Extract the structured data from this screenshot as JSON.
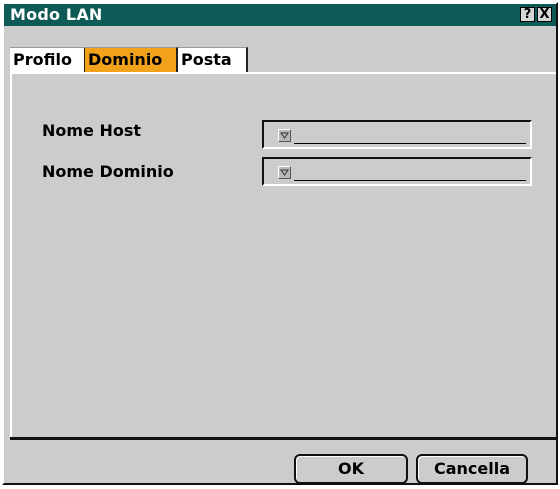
{
  "window": {
    "title": "Modo LAN",
    "help_label": "?",
    "close_label": "X"
  },
  "tabs": [
    {
      "label": "Profilo",
      "selected": false
    },
    {
      "label": "Dominio",
      "selected": true
    },
    {
      "label": "Posta",
      "selected": false
    }
  ],
  "fields": [
    {
      "label": "Nome Host",
      "value": ""
    },
    {
      "label": "Nome Dominio",
      "value": ""
    }
  ],
  "buttons": {
    "ok_label": "OK",
    "cancel_label": "Cancella"
  },
  "colors": {
    "titlebar": "#0e5a57",
    "active_tab": "#f2a21a",
    "background": "#cccccc"
  },
  "icons": {
    "dropdown": "chevron-down-icon"
  }
}
